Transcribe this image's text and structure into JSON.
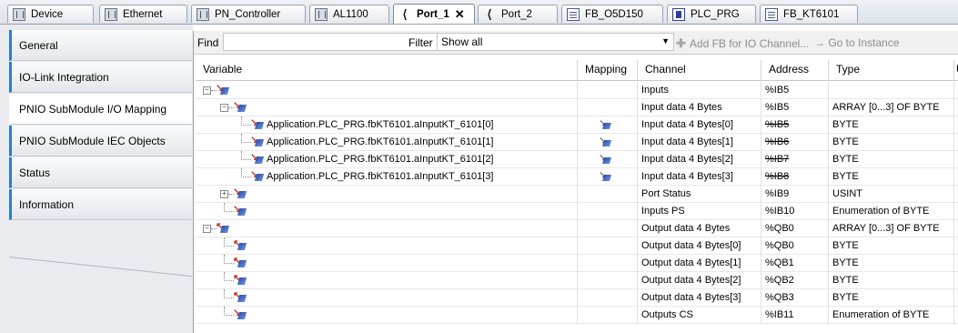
{
  "tabs": [
    {
      "label": "Device",
      "icon": "device-icon",
      "active": false
    },
    {
      "label": "Ethernet",
      "icon": "device-icon",
      "active": false
    },
    {
      "label": "PN_Controller",
      "icon": "device-icon",
      "active": false
    },
    {
      "label": "AL1100",
      "icon": "device-icon",
      "active": false
    },
    {
      "label": "Port_1",
      "icon": "port-icon",
      "active": true
    },
    {
      "label": "Port_2",
      "icon": "port-icon",
      "active": false
    },
    {
      "label": "FB_O5D150",
      "icon": "function-block-icon",
      "active": false
    },
    {
      "label": "PLC_PRG",
      "icon": "program-icon",
      "active": false
    },
    {
      "label": "FB_KT6101",
      "icon": "function-block-icon",
      "active": false
    }
  ],
  "sidebar": {
    "items": [
      {
        "label": "General",
        "active": false
      },
      {
        "label": "IO-Link Integration",
        "active": false
      },
      {
        "label": "PNIO SubModule I/O Mapping",
        "active": true
      },
      {
        "label": "PNIO SubModule IEC Objects",
        "active": false
      },
      {
        "label": "Status",
        "active": false
      },
      {
        "label": "Information",
        "active": false
      }
    ]
  },
  "toolbar": {
    "find_label": "Find",
    "find_value": "",
    "filter_label": "Filter",
    "filter_value": "Show all",
    "add_fb_label": "Add FB for IO Channel...",
    "goto_label": "Go to Instance"
  },
  "grid": {
    "columns": [
      "Variable",
      "Mapping",
      "Channel",
      "Address",
      "Type",
      "U"
    ],
    "rows": [
      {
        "variable": "",
        "mapped": false,
        "channel": "Inputs",
        "address": "%IB5",
        "address_struck": false,
        "type": ""
      },
      {
        "variable": "",
        "mapped": false,
        "channel": "Input data 4 Bytes",
        "address": "%IB5",
        "address_struck": false,
        "type": "ARRAY [0...3] OF BYTE"
      },
      {
        "variable": "Application.PLC_PRG.fbKT6101.aInputKT_6101[0]",
        "mapped": true,
        "channel": "Input data 4 Bytes[0]",
        "address": "%IB5",
        "address_struck": true,
        "type": "BYTE"
      },
      {
        "variable": "Application.PLC_PRG.fbKT6101.aInputKT_6101[1]",
        "mapped": true,
        "channel": "Input data 4 Bytes[1]",
        "address": "%IB6",
        "address_struck": true,
        "type": "BYTE"
      },
      {
        "variable": "Application.PLC_PRG.fbKT6101.aInputKT_6101[2]",
        "mapped": true,
        "channel": "Input data 4 Bytes[2]",
        "address": "%IB7",
        "address_struck": true,
        "type": "BYTE"
      },
      {
        "variable": "Application.PLC_PRG.fbKT6101.aInputKT_6101[3]",
        "mapped": true,
        "channel": "Input data 4 Bytes[3]",
        "address": "%IB8",
        "address_struck": true,
        "type": "BYTE"
      },
      {
        "variable": "",
        "mapped": false,
        "channel": "Port Status",
        "address": "%IB9",
        "address_struck": false,
        "type": "USINT"
      },
      {
        "variable": "",
        "mapped": false,
        "channel": "Inputs PS",
        "address": "%IB10",
        "address_struck": false,
        "type": "Enumeration of BYTE"
      },
      {
        "variable": "",
        "mapped": false,
        "channel": "Output data 4 Bytes",
        "address": "%QB0",
        "address_struck": false,
        "type": "ARRAY [0...3] OF BYTE"
      },
      {
        "variable": "",
        "mapped": false,
        "channel": "Output data 4 Bytes[0]",
        "address": "%QB0",
        "address_struck": false,
        "type": "BYTE"
      },
      {
        "variable": "",
        "mapped": false,
        "channel": "Output data 4 Bytes[1]",
        "address": "%QB1",
        "address_struck": false,
        "type": "BYTE"
      },
      {
        "variable": "",
        "mapped": false,
        "channel": "Output data 4 Bytes[2]",
        "address": "%QB2",
        "address_struck": false,
        "type": "BYTE"
      },
      {
        "variable": "",
        "mapped": false,
        "channel": "Output data 4 Bytes[3]",
        "address": "%QB3",
        "address_struck": false,
        "type": "BYTE"
      },
      {
        "variable": "",
        "mapped": false,
        "channel": "Outputs CS",
        "address": "%IB11",
        "address_struck": false,
        "type": "Enumeration of BYTE"
      }
    ]
  },
  "colors": {
    "accent": "#2f7fc6",
    "io_arrow": "#c62a1f",
    "io_block": "#2a4ea8"
  }
}
